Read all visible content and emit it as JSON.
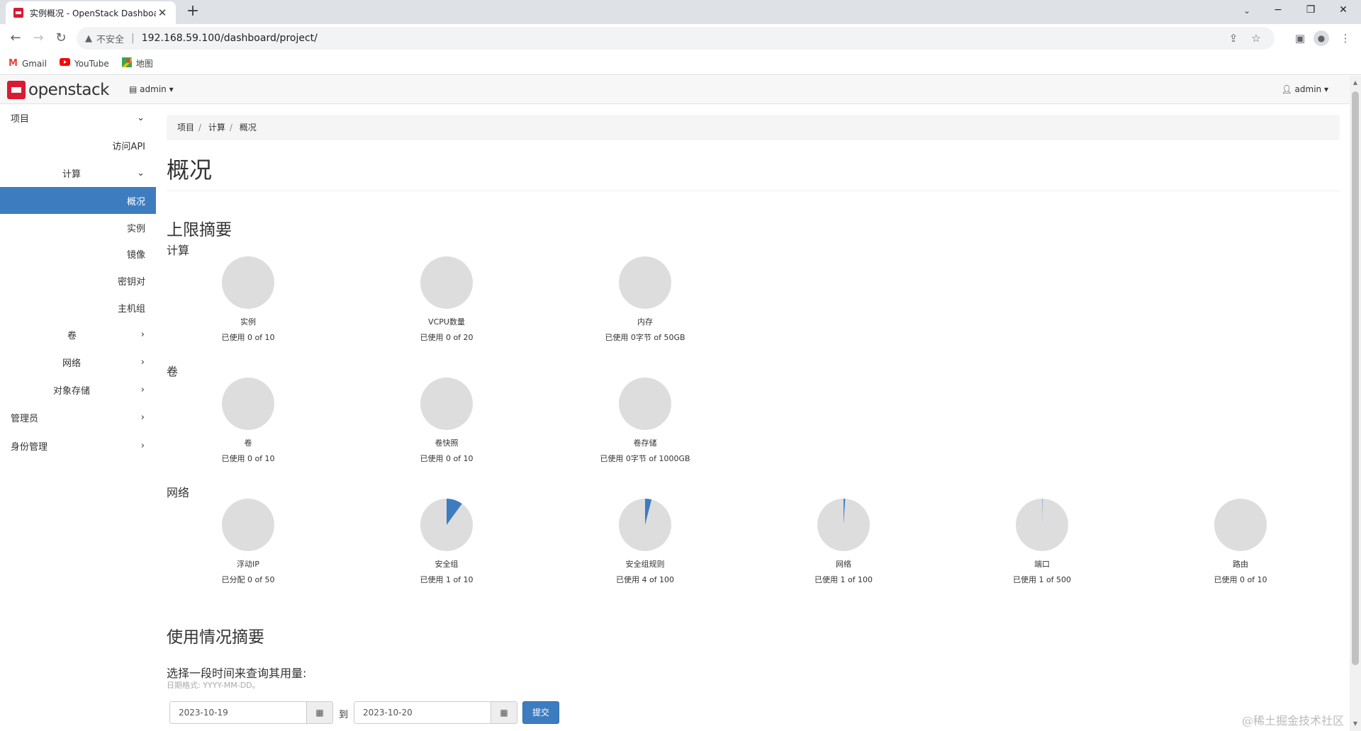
{
  "browser": {
    "tab_title": "实例概况 - OpenStack Dashboard",
    "tab_close": "✕",
    "new_tab": "+",
    "url": "192.168.59.100/dashboard/project/",
    "security_label": "不安全",
    "bookmarks": [
      {
        "icon": "gmail-icon",
        "label": "Gmail"
      },
      {
        "icon": "youtube-icon",
        "label": "YouTube"
      },
      {
        "icon": "maps-icon",
        "label": "地图"
      }
    ]
  },
  "header": {
    "logo_text": "openstack",
    "project_label": "admin",
    "user_label": "admin"
  },
  "sidebar": {
    "project": "项目",
    "access_api": "访问API",
    "compute": "计算",
    "overview": "概况",
    "instances": "实例",
    "images": "镜像",
    "keypairs": "密钥对",
    "server_groups": "主机组",
    "volumes": "卷",
    "network": "网络",
    "object_store": "对象存储",
    "admin": "管理员",
    "identity": "身份管理"
  },
  "breadcrumb": [
    "项目",
    "计算",
    "概况"
  ],
  "page_title": "概况",
  "limit_summary_title": "上限摘要",
  "groups": {
    "compute": "计算",
    "volume": "卷",
    "network": "网络"
  },
  "pies": {
    "compute": [
      {
        "label": "实例",
        "usage": "已使用 0 of 10",
        "used": 0,
        "total": 10
      },
      {
        "label": "VCPU数量",
        "usage": "已使用 0 of 20",
        "used": 0,
        "total": 20
      },
      {
        "label": "内存",
        "usage": "已使用 0字节 of 50GB",
        "used": 0,
        "total": 50
      }
    ],
    "volume": [
      {
        "label": "卷",
        "usage": "已使用 0 of 10",
        "used": 0,
        "total": 10
      },
      {
        "label": "卷快照",
        "usage": "已使用 0 of 10",
        "used": 0,
        "total": 10
      },
      {
        "label": "卷存储",
        "usage": "已使用 0字节 of 1000GB",
        "used": 0,
        "total": 1000
      }
    ],
    "network": [
      {
        "label": "浮动IP",
        "usage": "已分配 0 of 50",
        "used": 0,
        "total": 50
      },
      {
        "label": "安全组",
        "usage": "已使用 1 of 10",
        "used": 1,
        "total": 10
      },
      {
        "label": "安全组规则",
        "usage": "已使用 4 of 100",
        "used": 4,
        "total": 100
      },
      {
        "label": "网络",
        "usage": "已使用 1 of 100",
        "used": 1,
        "total": 100
      },
      {
        "label": "端口",
        "usage": "已使用 1 of 500",
        "used": 1,
        "total": 500
      },
      {
        "label": "路由",
        "usage": "已使用 0 of 10",
        "used": 0,
        "total": 10
      }
    ]
  },
  "pie_colors": {
    "empty": "#dddddd",
    "used": "#3d7dbf"
  },
  "usage": {
    "title": "使用情况摘要",
    "query_label": "选择一段时间来查询其用量:",
    "date_help": "日期格式: YYYY-MM-DD。",
    "start_date": "2023-10-19",
    "end_date": "2023-10-20",
    "to_label": "到",
    "submit_label": "提交"
  },
  "watermark": "@稀土掘金技术社区"
}
